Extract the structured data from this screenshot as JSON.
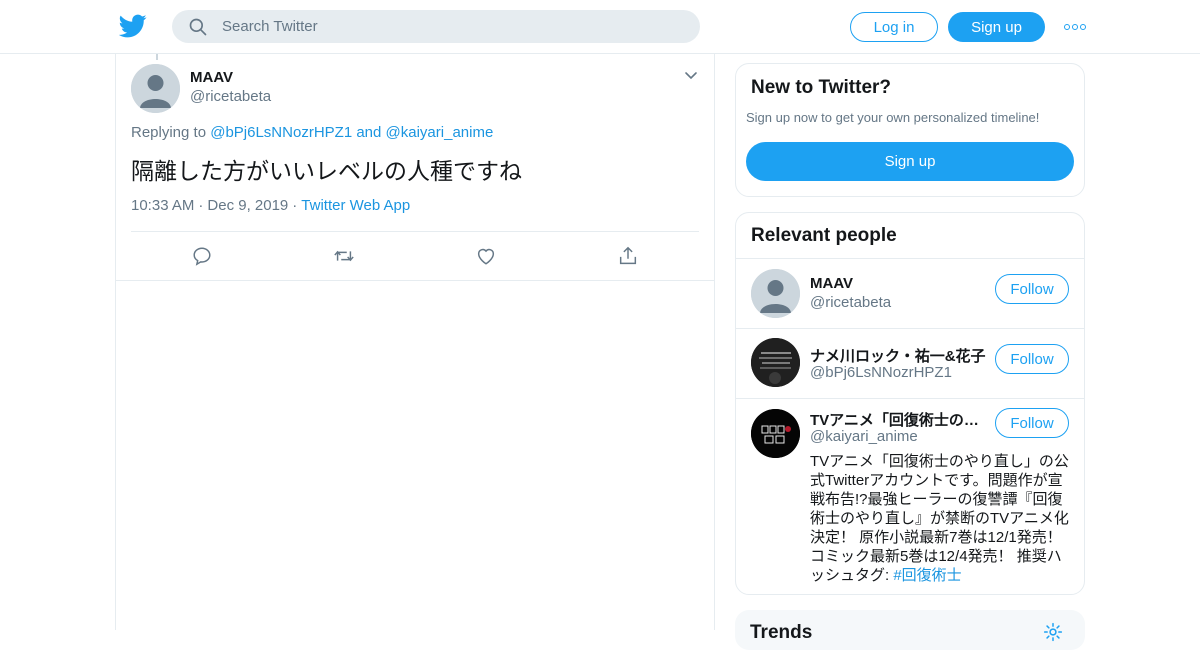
{
  "header": {
    "search_placeholder": "Search Twitter",
    "login_label": "Log in",
    "signup_label": "Sign up",
    "brand_color": "#1da1f2"
  },
  "tweet": {
    "name": "MAAV",
    "handle": "@ricetabeta",
    "replying_prefix": "Replying to",
    "reply_to_1": "@bPj6LsNNozrHPZ1",
    "reply_and": "and",
    "reply_to_2": "@kaiyari_anime",
    "text": "隔離した方がいいレベルの人種ですね",
    "time": "10:33 AM",
    "date": "Dec 9, 2019",
    "source": "Twitter Web App",
    "actions": [
      "reply-icon",
      "retweet-icon",
      "like-icon",
      "share-icon"
    ]
  },
  "new_to_twitter": {
    "title": "New to Twitter?",
    "subtitle": "Sign up now to get your own personalized timeline!",
    "signup_label": "Sign up"
  },
  "relevant_people": {
    "title": "Relevant people",
    "people": [
      {
        "name": "MAAV",
        "handle": "@ricetabeta",
        "follow_label": "Follow"
      },
      {
        "name": "ナメ川ロック・祐一&花子",
        "handle": "@bPj6LsNNozrHPZ1",
        "follow_label": "Follow"
      },
      {
        "name": "TVアニメ「回復術士の…",
        "handle": "@kaiyari_anime",
        "follow_label": "Follow",
        "bio": "TVアニメ「回復術士のやり直し」の公式Twitterアカウントです。問題作が宣戦布告!?最強ヒーラーの復讐譚『回復術士のやり直し』が禁断のTVアニメ化決定！ 原作小説最新7巻は12/1発売！ コミック最新5巻は12/4発売！ 推奨ハッシュタグ:",
        "bio_tag": "#回復術士"
      }
    ]
  },
  "trends": {
    "title": "Trends"
  }
}
